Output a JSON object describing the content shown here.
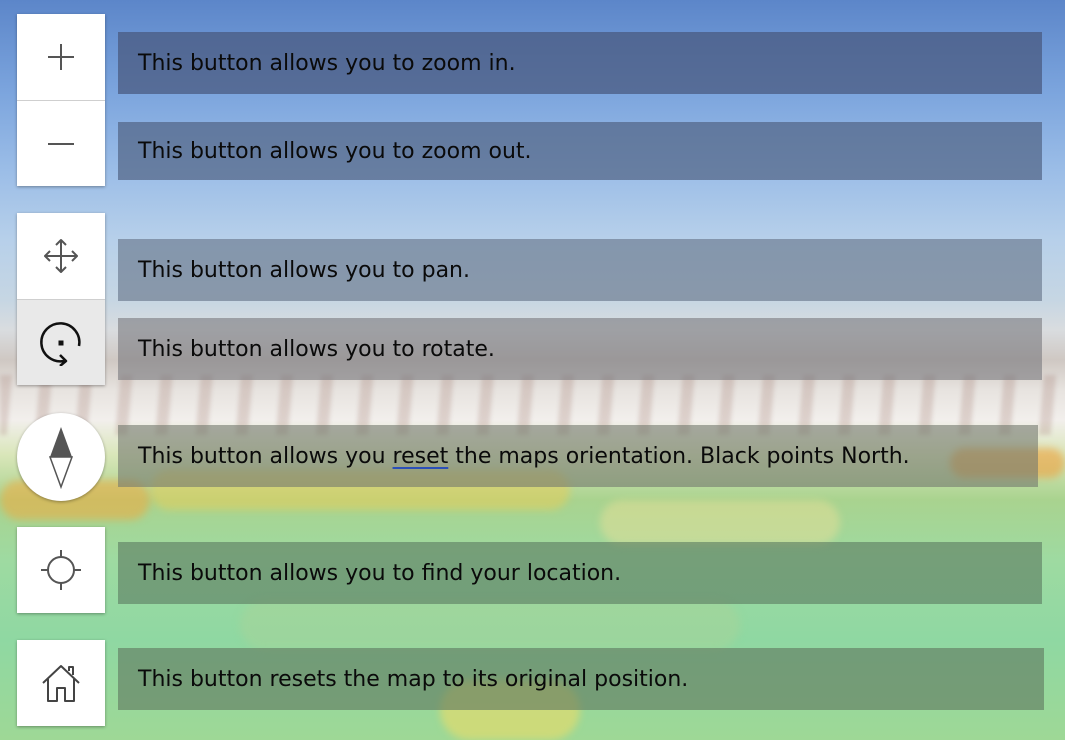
{
  "map": {
    "colors": {
      "sky": "#6f9bd6",
      "snow": "#f2efec",
      "vegetation": "#9edaa1",
      "caption_overlay": "rgba(60,75,100,0.6)"
    }
  },
  "controls": {
    "zoom_in": {
      "icon": "plus-icon"
    },
    "zoom_out": {
      "icon": "minus-icon"
    },
    "pan": {
      "icon": "pan-arrows-icon"
    },
    "rotate": {
      "icon": "rotate-icon"
    },
    "compass": {
      "icon": "compass-icon"
    },
    "locate": {
      "icon": "crosshair-icon"
    },
    "home": {
      "icon": "home-icon"
    }
  },
  "captions": {
    "zoom_in": "This button allows you to zoom in.",
    "zoom_out": "This button allows you to zoom out.",
    "pan": "This button allows you to pan.",
    "rotate": "This button allows you to rotate.",
    "compass": {
      "before": "This button allows you ",
      "misspelled": "reset",
      "after": " the maps orientation. Black points North."
    },
    "locate": "This button allows you to find your location.",
    "home": "This button resets the map to its original position."
  }
}
